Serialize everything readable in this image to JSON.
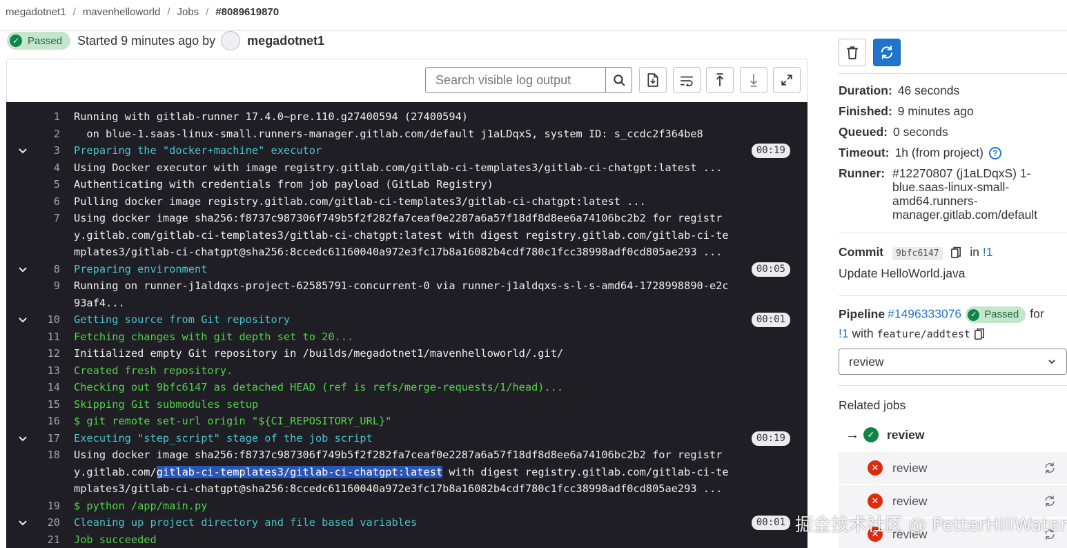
{
  "breadcrumb": [
    "megadotnet1",
    "mavenhelloworld",
    "Jobs",
    "#8089619870"
  ],
  "job": {
    "status": "Passed",
    "started_text": "Started 9 minutes ago by",
    "user": "megadotnet1"
  },
  "toolbar": {
    "search_placeholder": "Search visible log output"
  },
  "log": [
    {
      "n": "1",
      "text": "Running with gitlab-runner 17.4.0~pre.110.g27400594 (27400594)",
      "color": "white"
    },
    {
      "n": "2",
      "text": "  on blue-1.saas-linux-small.runners-manager.gitlab.com/default j1aLDqxS, system ID: s_ccdc2f364be8",
      "color": "white"
    },
    {
      "n": "3",
      "text": "Preparing the \"docker+machine\" executor",
      "color": "cyan",
      "section": true,
      "duration": "00:19"
    },
    {
      "n": "4",
      "text": "Using Docker executor with image registry.gitlab.com/gitlab-ci-templates3/gitlab-ci-chatgpt:latest ...",
      "color": "white"
    },
    {
      "n": "5",
      "text": "Authenticating with credentials from job payload (GitLab Registry)",
      "color": "white"
    },
    {
      "n": "6",
      "text": "Pulling docker image registry.gitlab.com/gitlab-ci-templates3/gitlab-ci-chatgpt:latest ...",
      "color": "white"
    },
    {
      "n": "7",
      "text": "Using docker image sha256:f8737c987306f749b5f2f282fa7ceaf0e2287a6a57f18df8d8ee6a74106bc2b2 for registr",
      "color": "white"
    },
    {
      "n": "",
      "text": "y.gitlab.com/gitlab-ci-templates3/gitlab-ci-chatgpt:latest with digest registry.gitlab.com/gitlab-ci-te",
      "color": "white"
    },
    {
      "n": "",
      "text": "mplates3/gitlab-ci-chatgpt@sha256:8ccedc61160040a972e3fc17b8a16082b4cdf780c1fcc38998adf0cd805ae293 ...",
      "color": "white"
    },
    {
      "n": "8",
      "text": "Preparing environment",
      "color": "cyan",
      "section": true,
      "duration": "00:05"
    },
    {
      "n": "9",
      "text": "Running on runner-j1aldqxs-project-62585791-concurrent-0 via runner-j1aldqxs-s-l-s-amd64-1728998890-e2c",
      "color": "white"
    },
    {
      "n": "",
      "text": "93af4...",
      "color": "white"
    },
    {
      "n": "10",
      "text": "Getting source from Git repository",
      "color": "cyan",
      "section": true,
      "duration": "00:01"
    },
    {
      "n": "11",
      "text": "Fetching changes with git depth set to 20...",
      "color": "green"
    },
    {
      "n": "12",
      "text": "Initialized empty Git repository in /builds/megadotnet1/mavenhelloworld/.git/",
      "color": "white"
    },
    {
      "n": "13",
      "text": "Created fresh repository.",
      "color": "green"
    },
    {
      "n": "14",
      "text": "Checking out 9bfc6147 as detached HEAD (ref is refs/merge-requests/1/head)...",
      "color": "green"
    },
    {
      "n": "15",
      "text": "Skipping Git submodules setup",
      "color": "green"
    },
    {
      "n": "16",
      "text": "$ git remote set-url origin \"${CI_REPOSITORY_URL}\"",
      "color": "green"
    },
    {
      "n": "17",
      "text": "Executing \"step_script\" stage of the job script",
      "color": "cyan",
      "section": true,
      "duration": "00:19"
    },
    {
      "n": "18",
      "text": "Using docker image sha256:f8737c987306f749b5f2f282fa7ceaf0e2287a6a57f18df8d8ee6a74106bc2b2 for registr",
      "color": "white"
    },
    {
      "n": "",
      "text": "y.gitlab.com/",
      "color": "white",
      "hl": "gitlab-ci-templates3/gitlab-ci-chatgpt:latest",
      "after": " with digest registry.gitlab.com/gitlab-ci-te"
    },
    {
      "n": "",
      "text": "mplates3/gitlab-ci-chatgpt@sha256:8ccedc61160040a972e3fc17b8a16082b4cdf780c1fcc38998adf0cd805ae293 ...",
      "color": "white"
    },
    {
      "n": "19",
      "text": "$ python /app/main.py",
      "color": "green"
    },
    {
      "n": "20",
      "text": "Cleaning up project directory and file based variables",
      "color": "cyan",
      "section": true,
      "duration": "00:01"
    },
    {
      "n": "21",
      "text": "Job succeeded",
      "color": "green"
    }
  ],
  "sidebar": {
    "duration_label": "Duration:",
    "duration": "46 seconds",
    "finished_label": "Finished:",
    "finished": "9 minutes ago",
    "queued_label": "Queued:",
    "queued": "0 seconds",
    "timeout_label": "Timeout:",
    "timeout": "1h (from project)",
    "runner_label": "Runner:",
    "runner": "#12270807 (j1aLDqxS) 1-blue.saas-linux-small-amd64.runners-manager.gitlab.com/default",
    "commit_label": "Commit",
    "commit_sha": "9bfc6147",
    "commit_in": "in",
    "commit_mr": "!1",
    "commit_message": "Update HelloWorld.java",
    "pipeline_label": "Pipeline",
    "pipeline_id": "#1496333076",
    "pipeline_status": "Passed",
    "pipeline_for": "for",
    "pipeline_mr": "!1",
    "pipeline_with": "with",
    "pipeline_branch": "feature/addtest",
    "stage": "review",
    "related_title": "Related jobs",
    "related_jobs": [
      {
        "name": "review",
        "status": "success",
        "current": true
      },
      {
        "name": "review",
        "status": "failed",
        "current": false
      },
      {
        "name": "review",
        "status": "failed",
        "current": false
      },
      {
        "name": "review",
        "status": "failed",
        "current": false
      }
    ]
  },
  "watermark": "掘金技术社区 @ PetterHillWater",
  "colors": {
    "accent": "#1f75cb",
    "success": "#108548",
    "danger": "#dd2b0e",
    "log_bg": "#1f1e24",
    "log_cyan": "#49c4cf",
    "log_green": "#52d34a"
  }
}
